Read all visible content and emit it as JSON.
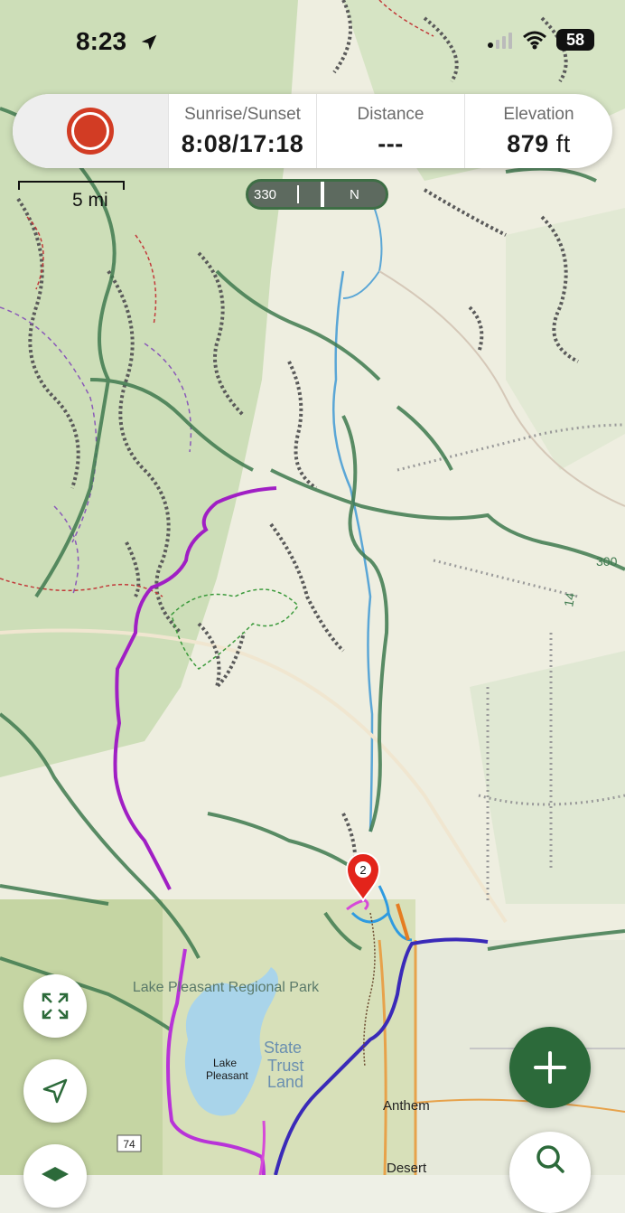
{
  "status_bar": {
    "time": "8:23",
    "battery": "58"
  },
  "info_panel": {
    "sunrise_sunset_label": "Sunrise/Sunset",
    "sunrise_sunset_value": "8:08/17:18",
    "distance_label": "Distance",
    "distance_value": "---",
    "elevation_label": "Elevation",
    "elevation_value": "879",
    "elevation_unit": "ft"
  },
  "map": {
    "scale_label": "5 mi",
    "compass_heading": "330",
    "compass_north": "N",
    "marker_label": "2",
    "labels": {
      "park": "Lake Pleasant Regional Park",
      "lake": "Lake Pleasant",
      "trust": "State Trust Land",
      "anthem": "Anthem",
      "desert": "Desert",
      "route_74": "74",
      "route_14": "14",
      "route_300": "300"
    }
  },
  "controls": {
    "fullscreen_icon": "fullscreen-icon",
    "locate_icon": "navigation-arrow-icon",
    "add_icon": "plus-icon",
    "layers_icon": "layers-icon",
    "search_icon": "search-icon"
  },
  "colors": {
    "record": "#d23c24",
    "primary_green": "#2c6a3a",
    "route_purple": "#a01fc4",
    "route_blue": "#3a2ab8",
    "marker_red": "#e3241b"
  }
}
